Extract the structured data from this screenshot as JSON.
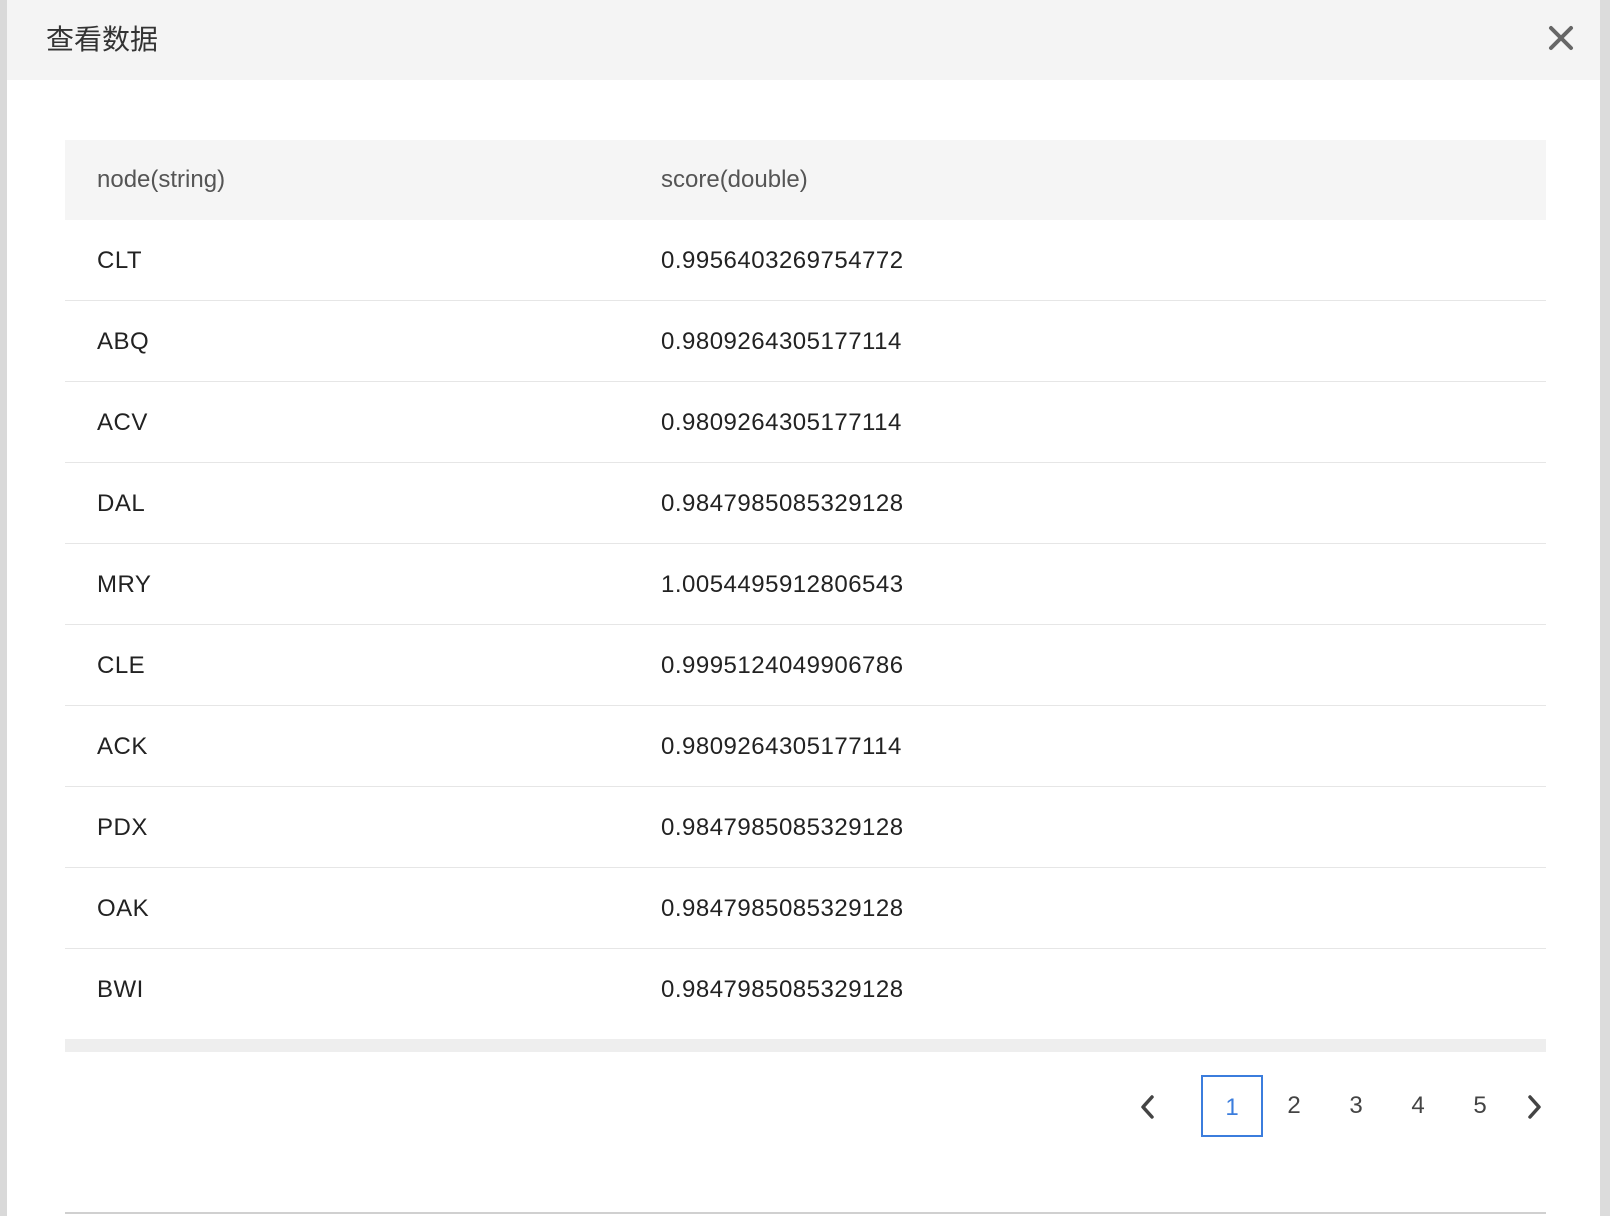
{
  "dialog": {
    "title": "查看数据",
    "close_icon": "close-icon"
  },
  "table": {
    "columns": [
      "node(string)",
      "score(double)"
    ],
    "rows": [
      [
        "CLT",
        "0.9956403269754772"
      ],
      [
        "ABQ",
        "0.9809264305177114"
      ],
      [
        "ACV",
        "0.9809264305177114"
      ],
      [
        "DAL",
        "0.9847985085329128"
      ],
      [
        "MRY",
        "1.0054495912806543"
      ],
      [
        "CLE",
        "0.9995124049906786"
      ],
      [
        "ACK",
        "0.9809264305177114"
      ],
      [
        "PDX",
        "0.9847985085329128"
      ],
      [
        "OAK",
        "0.9847985085329128"
      ],
      [
        "BWI",
        "0.9847985085329128"
      ]
    ]
  },
  "pagination": {
    "pages": [
      "1",
      "2",
      "3",
      "4",
      "5"
    ],
    "current_page": "1",
    "prev_icon": "chevron-left-icon",
    "next_icon": "chevron-right-icon"
  },
  "colors": {
    "accent": "#3b7ddd",
    "header_bg": "#f4f4f4",
    "table_header_bg": "#f5f5f5"
  }
}
